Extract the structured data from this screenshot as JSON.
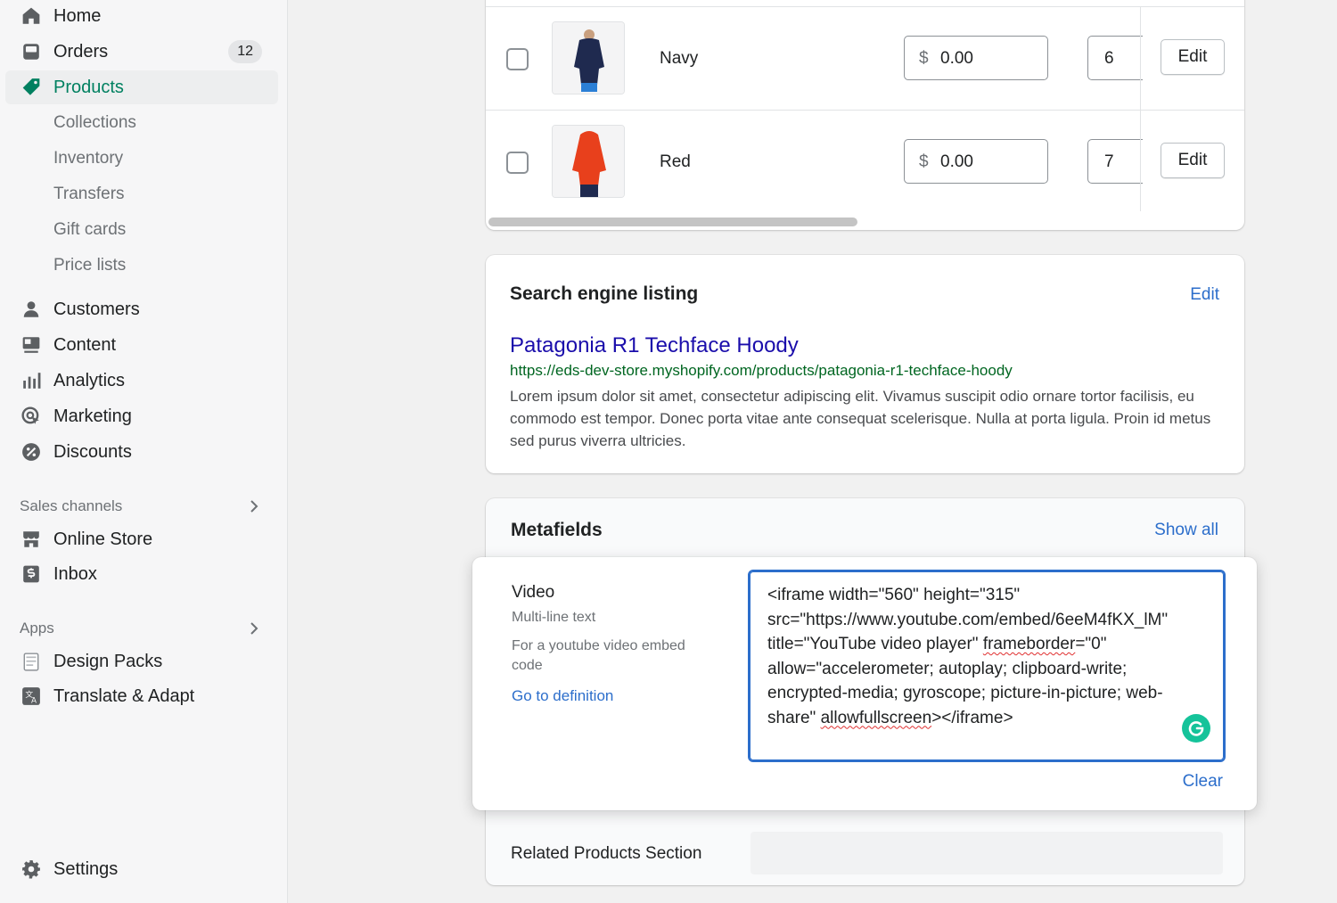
{
  "sidebar": {
    "primary": [
      {
        "label": "Home",
        "icon": "home-icon"
      },
      {
        "label": "Orders",
        "icon": "orders-icon",
        "badge": "12"
      },
      {
        "label": "Products",
        "icon": "tag-icon",
        "active": true
      }
    ],
    "product_subitems": [
      "Collections",
      "Inventory",
      "Transfers",
      "Gift cards",
      "Price lists"
    ],
    "secondary": [
      {
        "label": "Customers",
        "icon": "person-icon"
      },
      {
        "label": "Content",
        "icon": "content-icon"
      },
      {
        "label": "Analytics",
        "icon": "bar-chart-icon"
      },
      {
        "label": "Marketing",
        "icon": "target-icon"
      },
      {
        "label": "Discounts",
        "icon": "discount-icon"
      }
    ],
    "sales_channels": {
      "title": "Sales channels",
      "items": [
        {
          "label": "Online Store",
          "icon": "store-icon"
        },
        {
          "label": "Inbox",
          "icon": "inbox-icon"
        }
      ]
    },
    "apps": {
      "title": "Apps",
      "items": [
        {
          "label": "Design Packs",
          "icon": "design-packs-icon"
        },
        {
          "label": "Translate & Adapt",
          "icon": "translate-icon"
        }
      ]
    },
    "settings": {
      "label": "Settings",
      "icon": "gear-icon"
    }
  },
  "variants": [
    {
      "name": "Navy",
      "currency": "$",
      "price": "0.00",
      "quantity": "6",
      "edit_label": "Edit",
      "color": "#1f2a4f"
    },
    {
      "name": "Red",
      "currency": "$",
      "price": "0.00",
      "quantity": "7",
      "edit_label": "Edit",
      "color": "#e8401c"
    }
  ],
  "seo": {
    "title": "Search engine listing",
    "edit_label": "Edit",
    "page_title": "Patagonia R1 Techface Hoody",
    "url": "https://eds-dev-store.myshopify.com/products/patagonia-r1-techface-hoody",
    "description": "Lorem ipsum dolor sit amet, consectetur adipiscing elit. Vivamus suscipit odio ornare tortor facilisis, eu commodo est tempor. Donec porta vitae ante consequat scelerisque. Nulla at porta ligula. Proin id metus sed purus viverra ultricies."
  },
  "metafields": {
    "title": "Metafields",
    "show_all_label": "Show all",
    "video": {
      "label": "Video",
      "type": "Multi-line text",
      "description": "For a youtube video embed code",
      "definition_link": "Go to definition",
      "value_lines": [
        "<iframe width=\"560\" height=\"315\"",
        "src=\"https://www.youtube.com/embed/6eeM4fKX_lM\"",
        "title=\"YouTube video player\" ",
        "frameborder",
        "=\"0\"",
        "allow=\"accelerometer; autoplay; clipboard-write;",
        "encrypted-media; gyroscope; picture-in-picture; web-",
        "share\" ",
        "allowfullscreen",
        "></iframe>"
      ],
      "clear_label": "Clear"
    },
    "related_label": "Related Products Section"
  },
  "colors": {
    "accent": "#008060",
    "link": "#2c6ecb",
    "focus": "#2c6ecb",
    "seo_title": "#1a0dab",
    "seo_url": "#006621"
  }
}
